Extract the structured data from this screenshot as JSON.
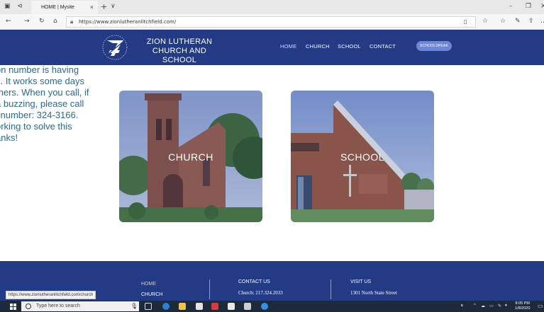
{
  "browser": {
    "tab_title": "HOME | Mysite",
    "tab_close": "×",
    "new_tab": "+",
    "tab_menu": "∨",
    "url": "https://www.zionlutheranlitchfield.com/",
    "window_min": "–",
    "window_max": "❐",
    "window_close": "×"
  },
  "site": {
    "name_line1": "ZION LUTHERAN",
    "name_line2": "CHURCH AND SCHOOL",
    "nav": [
      "HOME",
      "CHURCH",
      "SCHOOL",
      "CONTACT"
    ],
    "cta": "SCHOOLSPEAK"
  },
  "notice": {
    "lines": [
      "on number is having",
      "s. It works some days",
      "thers. When you call, if",
      "a buzzing, please call",
      "l number: 324-3166.",
      "orking to solve this",
      "anks!"
    ]
  },
  "cards": [
    {
      "label": "CHURCH"
    },
    {
      "label": "SCHOOL"
    }
  ],
  "footer": {
    "links": [
      "HOME",
      "CHURCH"
    ],
    "contact_heading": "CONTACT US",
    "contact_line": "Church: 217.324.2033",
    "visit_heading": "VISIT US",
    "visit_line": "1301 North State Street"
  },
  "status_url": "https://www.zionlutheranlitchfield.com/church",
  "taskbar": {
    "search_placeholder": "Type here to search",
    "time": "8:05 PM",
    "date": "1/8/2020"
  },
  "colors": {
    "brand_navy": "#233b84",
    "cta_blue": "#6f86d8",
    "notice_text": "#2f6b8a"
  }
}
